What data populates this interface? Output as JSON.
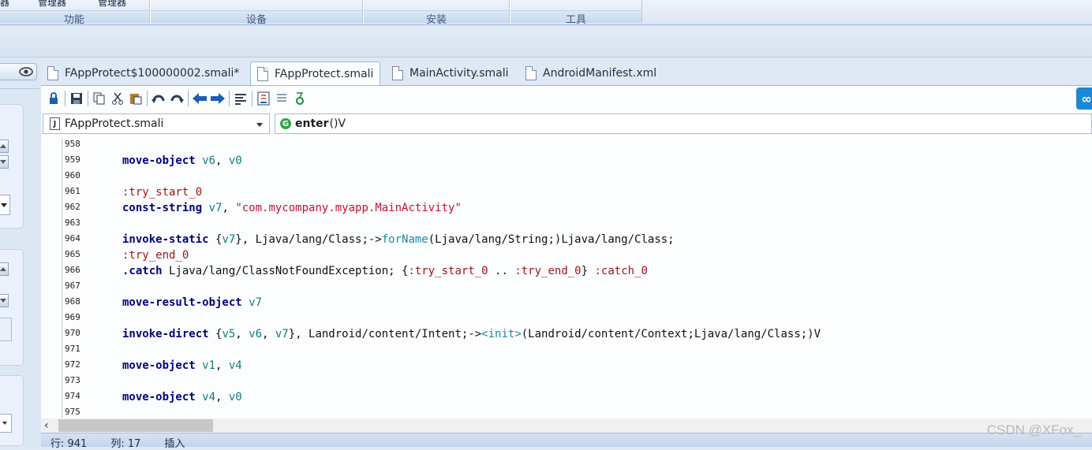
{
  "ribbon": {
    "top_labels": [
      "器",
      "管理器",
      "管理器"
    ],
    "groups": [
      "功能",
      "设备",
      "安装",
      "工具"
    ]
  },
  "tabs": [
    {
      "label": "FAppProtect$100000002.smali*",
      "active": false
    },
    {
      "label": "FAppProtect.smali",
      "active": true
    },
    {
      "label": "MainActivity.smali",
      "active": false
    },
    {
      "label": "AndroidManifest.xml",
      "active": false
    }
  ],
  "toolbar": {
    "icons": [
      "lock-icon",
      "save-icon",
      "copy-icon",
      "cut-icon",
      "paste-icon",
      "undo-icon",
      "redo-icon",
      "back-icon",
      "forward-icon",
      "format-icon",
      "java-icon",
      "list-icon",
      "run-icon"
    ]
  },
  "navigation": {
    "class_combo": {
      "icon": "J",
      "value": "FAppProtect.smali"
    },
    "method_combo": {
      "icon": "G",
      "method": "enter",
      "signature": "()V"
    }
  },
  "code": {
    "lines": [
      {
        "num": "958",
        "text": ""
      },
      {
        "num": "959",
        "text": "    move-object v6, v0"
      },
      {
        "num": "960",
        "text": ""
      },
      {
        "num": "961",
        "text": "    :try_start_0"
      },
      {
        "num": "962",
        "text": "    const-string v7, \"com.mycompany.myapp.MainActivity\""
      },
      {
        "num": "963",
        "text": ""
      },
      {
        "num": "964",
        "text": "    invoke-static {v7}, Ljava/lang/Class;->forName(Ljava/lang/String;)Ljava/lang/Class;"
      },
      {
        "num": "965",
        "text": "    :try_end_0"
      },
      {
        "num": "966",
        "text": "    .catch Ljava/lang/ClassNotFoundException; {:try_start_0 .. :try_end_0} :catch_0"
      },
      {
        "num": "967",
        "text": ""
      },
      {
        "num": "968",
        "text": "    move-result-object v7"
      },
      {
        "num": "969",
        "text": ""
      },
      {
        "num": "970",
        "text": "    invoke-direct {v5, v6, v7}, Landroid/content/Intent;-><init>(Landroid/content/Context;Ljava/lang/Class;)V"
      },
      {
        "num": "971",
        "text": ""
      },
      {
        "num": "972",
        "text": "    move-object v1, v4"
      },
      {
        "num": "973",
        "text": ""
      },
      {
        "num": "974",
        "text": "    move-object v4, v0"
      },
      {
        "num": "975",
        "text": ""
      }
    ]
  },
  "status": {
    "row": "行: 941",
    "col": "列: 17",
    "mode": "插入"
  },
  "watermark": "CSDN @XFox_",
  "colors": {
    "keyword": "#00007f",
    "register": "#0f7c80",
    "string": "#c8102e",
    "label": "#a31515",
    "accent": "#1f86d6"
  }
}
